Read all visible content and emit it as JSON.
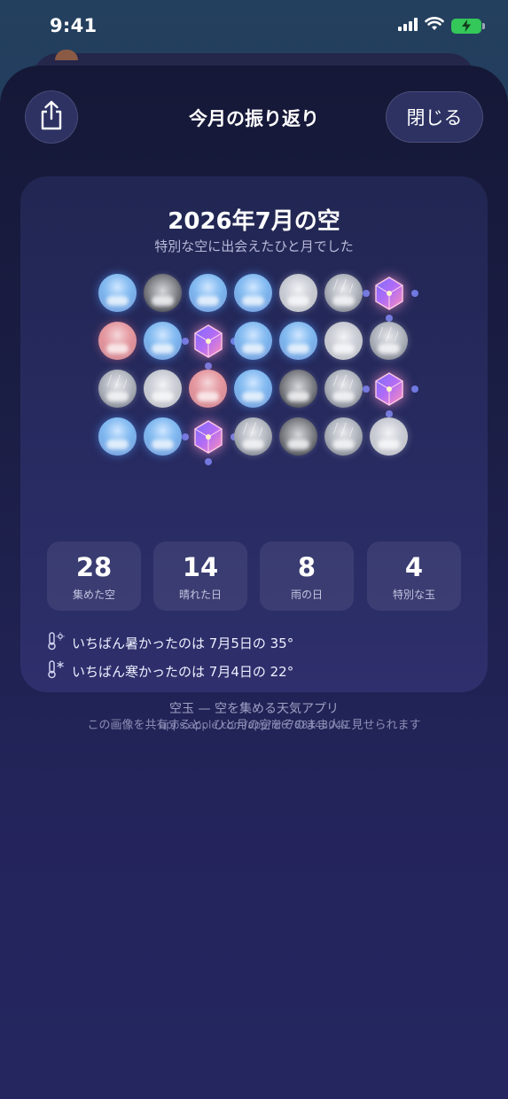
{
  "status_bar": {
    "time": "9:41",
    "signal_icon": "cellular-signal-icon",
    "wifi_icon": "wifi-icon",
    "battery_icon": "battery-charging-icon",
    "battery_color": "#34c759"
  },
  "header": {
    "share_icon": "share-icon",
    "title": "今月の振り返り",
    "close_label": "閉じる"
  },
  "card": {
    "title": "2026年7月の空",
    "subtitle": "特別な空に出会えたひと月でした",
    "orbs": [
      [
        "sunny",
        "dark",
        "sunny",
        "sunny",
        "cloudy",
        "rainy",
        "gem"
      ],
      [
        "sunset",
        "sunny",
        "gem",
        "sunny",
        "sunny",
        "cloudy",
        "rainy"
      ],
      [
        "rainy",
        "cloudy",
        "sunset",
        "sunny",
        "dark",
        "rainy",
        "gem"
      ],
      [
        "sunny",
        "sunny",
        "gem",
        "rainy",
        "dark",
        "rainy",
        "cloudy"
      ]
    ],
    "stats": [
      {
        "value": "28",
        "label": "集めた空"
      },
      {
        "value": "14",
        "label": "晴れた日"
      },
      {
        "value": "8",
        "label": "雨の日"
      },
      {
        "value": "4",
        "label": "特別な玉"
      }
    ],
    "hot_day": {
      "icon": "thermometer-sun-icon",
      "text": "いちばん暑かったのは 7月5日の 35°"
    },
    "cold_day": {
      "icon": "thermometer-snow-icon",
      "text": "いちばん寒かったのは 7月4日の 22°"
    },
    "app_line": "空玉 — 空を集める天気アプリ",
    "app_url": "apps.apple.com/app/id6788443049"
  },
  "share_hint": "この画像を共有すると、ひと月の空をそのまま人に見せられます",
  "colors": {
    "sheet_bg": "#1b1e45",
    "card_bg": "#262a5e",
    "accent_dot": "#6f78e0",
    "gem_glow": "#ff96d2"
  }
}
